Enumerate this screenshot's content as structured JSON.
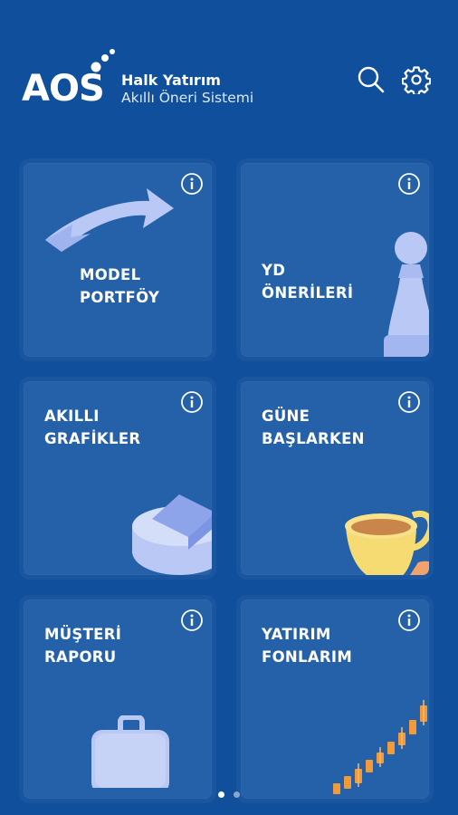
{
  "brand": {
    "logo_text": "AOS",
    "name": "Halk Yatırım",
    "subtitle": "Akıllı Öneri Sistemi"
  },
  "header_icons": {
    "search": "search-icon",
    "settings": "gear-icon"
  },
  "cards": [
    {
      "line1": "MODEL",
      "line2": "PORTFÖY",
      "icon": "swap-arrows-icon"
    },
    {
      "line1": "YD",
      "line2": "ÖNERİLERİ",
      "icon": "chess-pawn-icon"
    },
    {
      "line1": "AKILLI",
      "line2": "GRAFİKLER",
      "icon": "pie-chart-icon"
    },
    {
      "line1": "GÜNE",
      "line2": "BAŞLARKEN",
      "icon": "coffee-cup-icon"
    },
    {
      "line1": "MÜŞTERİ",
      "line2": "RAPORU",
      "icon": "briefcase-icon"
    },
    {
      "line1": "YATIRIM",
      "line2": "FONLARIM",
      "icon": "candlestick-chart-icon"
    }
  ],
  "pager": {
    "active_page": 1,
    "page_count": 2
  },
  "colors": {
    "background": "#0f4f9c",
    "card": "#2461a8",
    "accent_orange": "#f29a3a"
  }
}
